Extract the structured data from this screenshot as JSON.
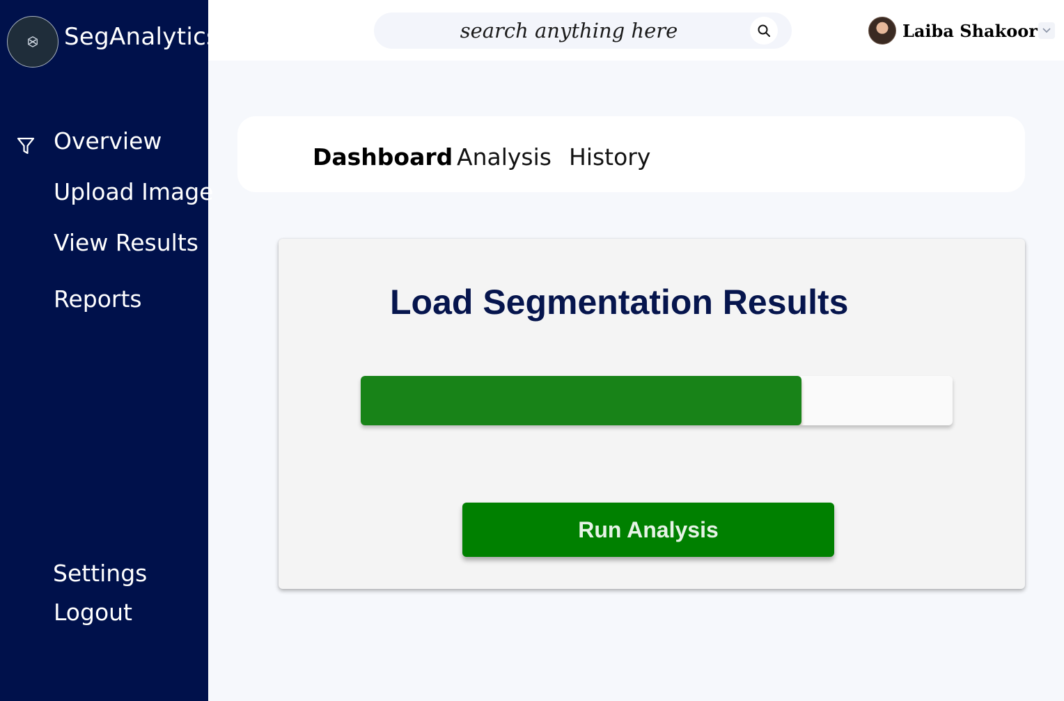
{
  "app": {
    "brand": "SegAnalytics"
  },
  "sidebar": {
    "items": [
      {
        "label": "Overview",
        "icon": "filter-icon"
      },
      {
        "label": "Upload Image"
      },
      {
        "label": "View Results"
      },
      {
        "label": "Reports"
      }
    ],
    "bottom_items": [
      {
        "label": "Settings"
      },
      {
        "label": "Logout"
      }
    ]
  },
  "header": {
    "search": {
      "placeholder": "search anything here",
      "icon": "search-icon"
    },
    "user": {
      "name": "Laiba Shakoor",
      "menu_icon": "chevron-down-icon"
    }
  },
  "tabs": [
    {
      "label": "Dashboard",
      "active": true
    },
    {
      "label": "Analysis",
      "active": false
    },
    {
      "label": "History",
      "active": false
    }
  ],
  "main": {
    "title": "Load Segmentation Results",
    "progress_fraction": 0.745,
    "run_button_label": "Run Analysis"
  },
  "colors": {
    "sidebar_bg": "#00114b",
    "progress_fill": "#188318",
    "run_button": "#008000",
    "title_text": "#06154d"
  }
}
